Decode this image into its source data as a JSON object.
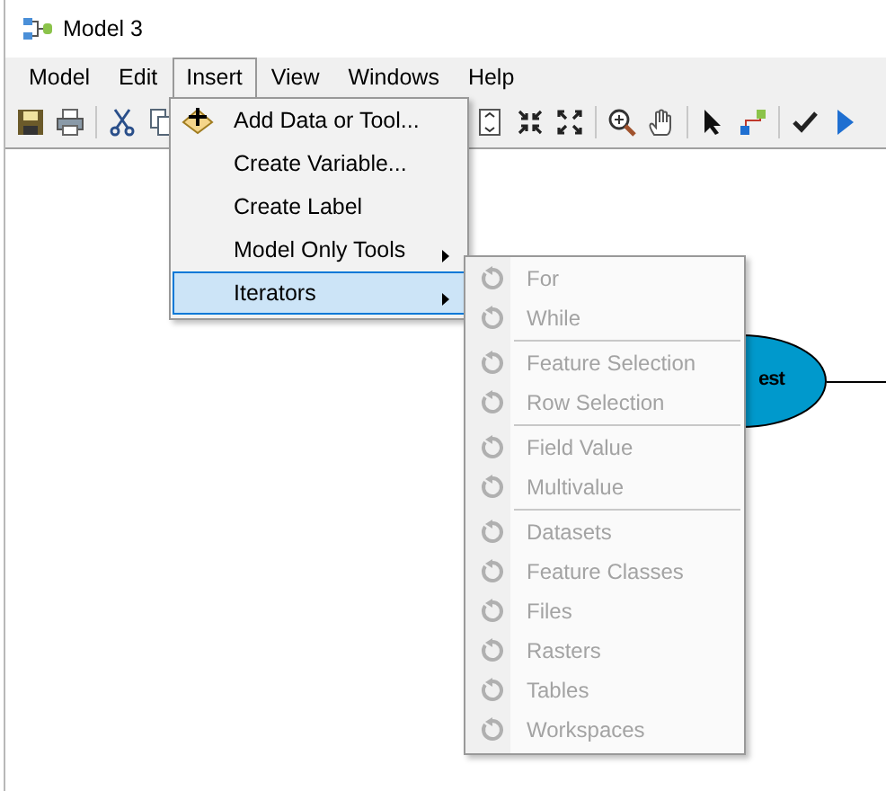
{
  "window": {
    "title": "Model 3"
  },
  "menu_bar": [
    {
      "label": "Model",
      "selected": false
    },
    {
      "label": "Edit",
      "selected": false
    },
    {
      "label": "Insert",
      "selected": true
    },
    {
      "label": "View",
      "selected": false
    },
    {
      "label": "Windows",
      "selected": false
    },
    {
      "label": "Help",
      "selected": false
    }
  ],
  "insert_menu": {
    "items": [
      {
        "label": "Add Data or Tool...",
        "icon": true,
        "has_submenu": false,
        "selected": false
      },
      {
        "label": "Create Variable...",
        "icon": false,
        "has_submenu": false,
        "selected": false
      },
      {
        "label": "Create Label",
        "icon": false,
        "has_submenu": false,
        "selected": false
      },
      {
        "label": "Model Only Tools",
        "icon": false,
        "has_submenu": true,
        "selected": false
      },
      {
        "label": "Iterators",
        "icon": false,
        "has_submenu": true,
        "selected": true
      }
    ]
  },
  "iterators_menu": {
    "groups": [
      {
        "items": [
          {
            "label": "For",
            "disabled": true
          },
          {
            "label": "While",
            "disabled": true
          }
        ]
      },
      {
        "items": [
          {
            "label": "Feature Selection",
            "disabled": true
          },
          {
            "label": "Row Selection",
            "disabled": true
          }
        ]
      },
      {
        "items": [
          {
            "label": "Field Value",
            "disabled": true
          },
          {
            "label": "Multivalue",
            "disabled": true
          }
        ]
      },
      {
        "items": [
          {
            "label": "Datasets",
            "disabled": true
          },
          {
            "label": "Feature Classes",
            "disabled": true
          },
          {
            "label": "Files",
            "disabled": true
          },
          {
            "label": "Rasters",
            "disabled": true
          },
          {
            "label": "Tables",
            "disabled": true
          },
          {
            "label": "Workspaces",
            "disabled": true
          }
        ]
      }
    ]
  },
  "canvas": {
    "nodes": [
      {
        "label": "est"
      }
    ]
  }
}
